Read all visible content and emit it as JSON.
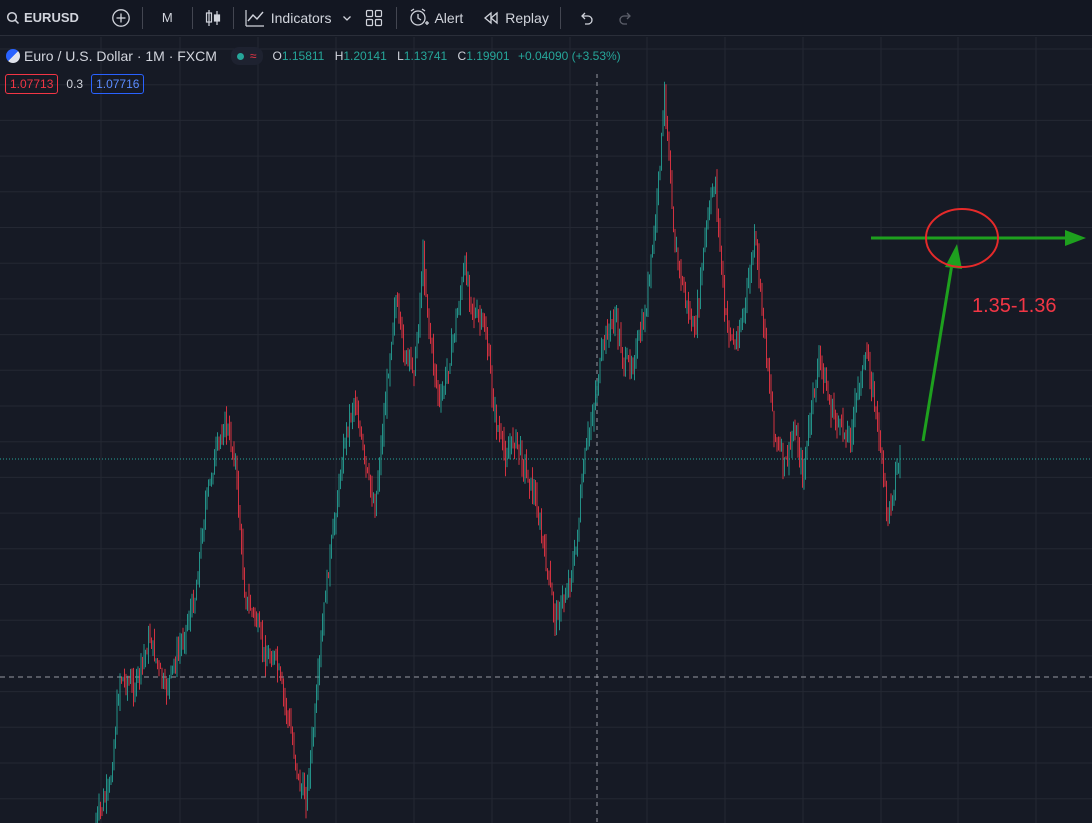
{
  "toolbar": {
    "symbol": "EURUSD",
    "interval": "M",
    "indicators_label": "Indicators",
    "alert_label": "Alert",
    "replay_label": "Replay"
  },
  "legend": {
    "title": "Euro / U.S. Dollar · 1M · FXCM",
    "o_label": "O",
    "o_value": "1.15811",
    "h_label": "H",
    "h_value": "1.20141",
    "l_label": "L",
    "l_value": "1.13741",
    "c_label": "C",
    "c_value": "1.19901",
    "change": "+0.04090 (+3.53%)",
    "status_symbol": "≈"
  },
  "prices": {
    "sell": "1.07713",
    "spread": "0.3",
    "buy": "1.07716"
  },
  "annotation": {
    "label": "1.35-1.36"
  },
  "colors": {
    "background": "#161a25",
    "up": "#26a69a",
    "down": "#f23645",
    "annotation_arrow": "#1ea01e",
    "annotation_circle": "#e52a2a"
  },
  "icons": [
    "search-icon",
    "add-symbol-icon",
    "candles-icon",
    "indicators-icon",
    "chevron-down-icon",
    "layout-icon",
    "alert-icon",
    "replay-icon",
    "undo-icon",
    "redo-icon"
  ]
}
